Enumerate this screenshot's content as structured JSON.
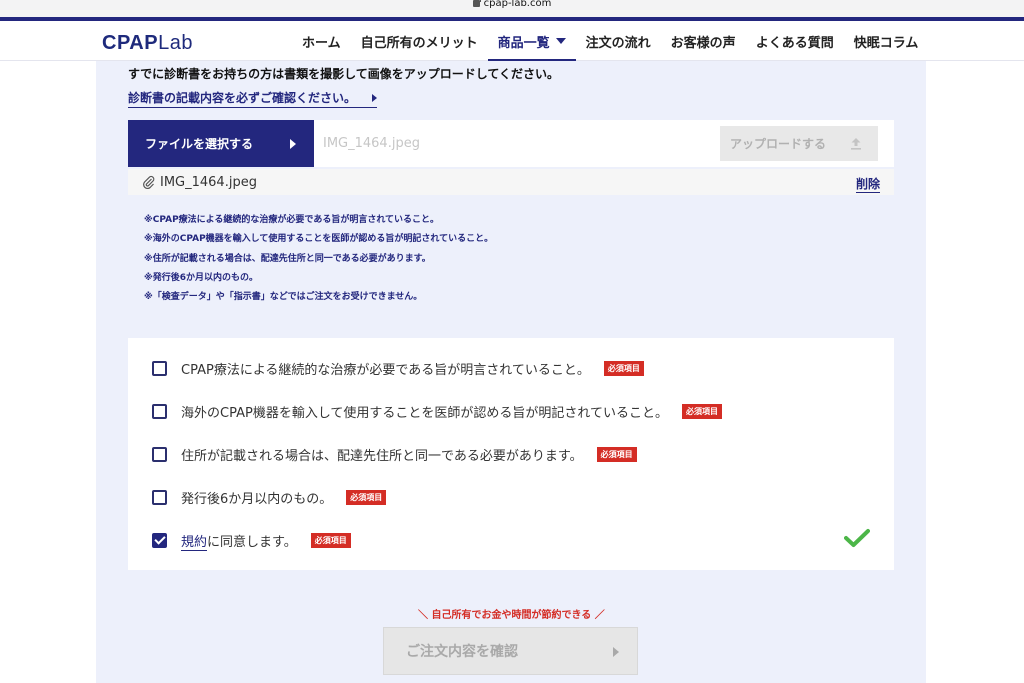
{
  "browser": {
    "url": "cpap-lab.com"
  },
  "header": {
    "logo": {
      "main": "CPAP",
      "sub": "Lab"
    },
    "nav": [
      {
        "label": "ホーム"
      },
      {
        "label": "自己所有のメリット"
      },
      {
        "label": "商品一覧",
        "active": true
      },
      {
        "label": "注文の流れ"
      },
      {
        "label": "お客様の声"
      },
      {
        "label": "よくある質問"
      },
      {
        "label": "快眠コラム"
      }
    ]
  },
  "upload": {
    "intro": "すでに診断書をお持ちの方は書類を撮影して画像をアップロードしてください。",
    "note_link": "診断書の記載内容を必ずご確認ください。",
    "choose_file_label": "ファイルを選択する",
    "selected_file": "IMG_1464.jpeg",
    "upload_label": "アップロードする",
    "attached_file": "IMG_1464.jpeg",
    "delete_label": "削除",
    "notes": [
      "※CPAP療法による継続的な治療が必要である旨が明言されていること。",
      "※海外のCPAP機器を輸入して使用することを医師が認める旨が明記されていること。",
      "※住所が記載される場合は、配達先住所と同一である必要があります。",
      "※発行後6か月以内のもの。",
      "※「検査データ」や「指示書」などではご注文をお受けできません。"
    ]
  },
  "checklist": {
    "required_badge": "必須項目",
    "items": [
      {
        "text": "CPAP療法による継続的な治療が必要である旨が明言されていること。",
        "checked": false
      },
      {
        "text": "海外のCPAP機器を輸入して使用することを医師が認める旨が明記されていること。",
        "checked": false
      },
      {
        "text": "住所が記載される場合は、配達先住所と同一である必要があります。",
        "checked": false
      },
      {
        "text": "発行後6か月以内のもの。",
        "checked": false
      },
      {
        "terms": "規約",
        "text": "に同意します。",
        "checked": true
      }
    ]
  },
  "footer": {
    "save_message": "＼ 自己所有でお金や時間が節約できる ／",
    "confirm_label": "ご注文内容を確認"
  },
  "colors": {
    "brand": "#23277e",
    "required": "#d42d25",
    "ok": "#4cb648"
  }
}
